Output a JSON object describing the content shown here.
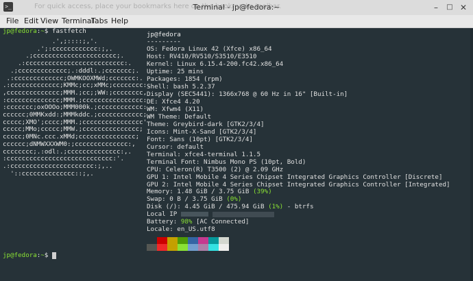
{
  "window": {
    "title": "Terminal - jp@fedora:~",
    "background_hint": "For quick access, place your bookmarks here on the bookmarks toolbar.",
    "icon": "terminal-app-icon",
    "controls": {
      "minimize": "–",
      "maximize": "□",
      "close": "✕"
    }
  },
  "menu": [
    "File",
    "Edit",
    "View",
    "Terminal",
    "Tabs",
    "Help"
  ],
  "terminal": {
    "prompt_user": "jp@fedora",
    "prompt_sep": ":",
    "prompt_path": "~",
    "prompt_char": "$",
    "command": "fastfetch",
    "logo_lines": [
      "             .',;::::;,'.",
      "         .';:cccccccccccc:;,.",
      "      .;cccccccccccccccccccccc;.",
      "    .:cccccccccccccccccccccccccc:.",
      "  .;ccccccccccccc;.:dddl:.;ccccccc;.",
      " .:ccccccccccccc;OWMKOOXMWd;ccccccc:.",
      ".:ccccccccccccc;KMMc;cc;xMMc;cccccccc:.",
      ",cccccccccccccc;MMM.;cc;;WW:;cccccccc,",
      ":cccccccccccccc;MMM.;cccccccccccccccc:",
      ":ccccccc;oxOOOo;MMM000k.;cccccccccccc:",
      "cccccc;0MMKxdd:;MMMkddc.;cccccccccccc;",
      "ccccc;XMO';cccc;MMM.;cccccccccccccccc'",
      "ccccc;MMo;ccccc;MMW.;ccccccccccccccc;",
      "ccccc;0MNc.ccc.xMMd;ccccccccccccccc;",
      "cccccc;dNMWXXXWM0:;cccccccccccccc:,",
      "cccccccc;.:odl:.;cccccccccccccc:,.",
      ":cccccccccccccccccccccccccccc:'.",
      ".:cccccccccccccccccccccc:;,..",
      "  '::cccccccccccccc::;,."
    ],
    "header_user": "jp@fedora",
    "header_sep": "---------",
    "info": [
      {
        "label": "OS",
        "value": "Fedora Linux 42 (Xfce) x86_64"
      },
      {
        "label": "Host",
        "value": "RV410/RV510/S3510/E3510"
      },
      {
        "label": "Kernel",
        "value": "Linux 6.15.4-200.fc42.x86_64"
      },
      {
        "label": "Uptime",
        "value": "25 mins"
      },
      {
        "label": "Packages",
        "value": "1854 (rpm)"
      },
      {
        "label": "Shell",
        "value": "bash 5.2.37"
      },
      {
        "label": "Display (SEC5441)",
        "value": "1366x768 @ 60 Hz in 16\" [Built-in]"
      },
      {
        "label": "DE",
        "value": "Xfce4 4.20"
      },
      {
        "label": "WM",
        "value": "Xfwm4 (X11)"
      },
      {
        "label": "WM Theme",
        "value": "Default"
      },
      {
        "label": "Theme",
        "value": "Greybird-dark [GTK2/3/4]"
      },
      {
        "label": "Icons",
        "value": "Mint-X-Sand [GTK2/3/4]"
      },
      {
        "label": "Font",
        "value": "Sans (10pt) [GTK2/3/4]"
      },
      {
        "label": "Cursor",
        "value": "default"
      },
      {
        "label": "Terminal",
        "value": "xfce4-terminal 1.1.5"
      },
      {
        "label": "Terminal Font",
        "value": "Nimbus Mono PS (10pt, Bold)"
      },
      {
        "label": "CPU",
        "value": "Celeron(R) T3500 (2) @ 2.09 GHz"
      },
      {
        "label": "GPU 1",
        "value": "Intel Mobile 4 Series Chipset Integrated Graphics Controller [Discrete]"
      },
      {
        "label": "GPU 2",
        "value": "Intel Mobile 4 Series Chipset Integrated Graphics Controller [Integrated]"
      }
    ],
    "memory": {
      "label": "Memory",
      "value": "1.48 GiB / 3.75 GiB",
      "pct": "(39%)"
    },
    "swap": {
      "label": "Swap",
      "value": "0 B / 3.75 GiB",
      "pct": "(0%)"
    },
    "disk": {
      "label": "Disk (/)",
      "value": "4.45 GiB / 475.94 GiB",
      "pct": "(1%)",
      "suffix": "- btrfs"
    },
    "local_ip": {
      "label": "Local IP"
    },
    "battery": {
      "label": "Battery",
      "pct": "98%",
      "suffix": "[AC Connected]"
    },
    "locale": {
      "label": "Locale",
      "value": "en_US.utf8"
    },
    "palette_top": [
      "#263238",
      "#cc0000",
      "#c4a000",
      "#4e9a06",
      "#3465a4",
      "#c53a8f",
      "#06989a",
      "#d3d7cf"
    ],
    "palette_bottom": [
      "#555753",
      "#ef2929",
      "#c4a000",
      "#8ae234",
      "#729fcf",
      "#ad7fa8",
      "#34e2e2",
      "#eeeeec"
    ]
  },
  "colors": {
    "prompt": "#8ae234",
    "background": "#263238",
    "foreground": "#e0e0e0"
  }
}
